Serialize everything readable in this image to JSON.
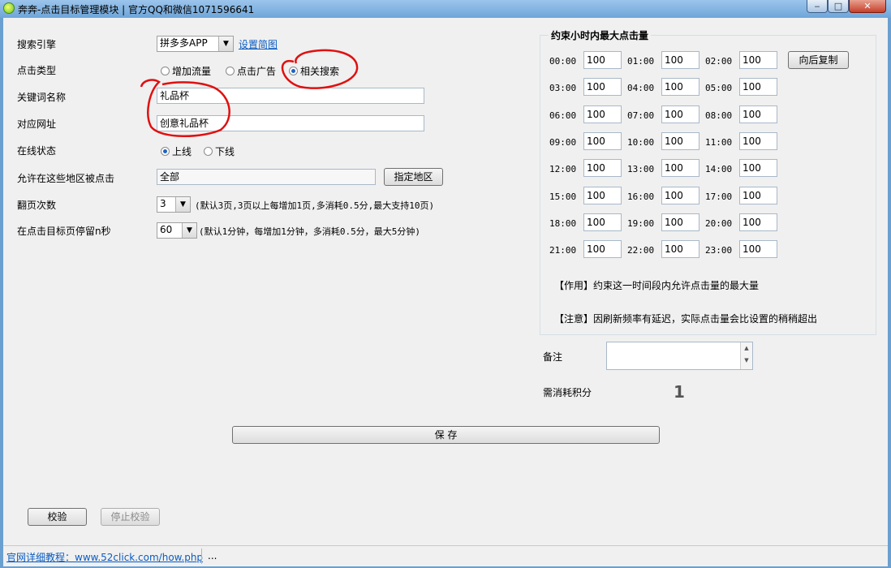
{
  "window": {
    "title": "奔奔-点击目标管理模块 | 官方QQ和微信1071596641",
    "minimize": "‒",
    "maximize": "□",
    "close": "✕"
  },
  "form": {
    "search_engine": {
      "label": "搜索引擎",
      "value": "拼多多APP",
      "link": "设置简图"
    },
    "click_type": {
      "label": "点击类型",
      "options": [
        "增加流量",
        "点击广告",
        "相关搜索"
      ],
      "selected": "相关搜索"
    },
    "keyword": {
      "label": "关键词名称",
      "value": "礼品杯"
    },
    "url": {
      "label": "对应网址",
      "value": "创意礼品杯"
    },
    "status": {
      "label": "在线状态",
      "options": [
        "上线",
        "下线"
      ],
      "selected": "上线"
    },
    "regions": {
      "label": "允许在这些地区被点击",
      "value": "全部",
      "button": "指定地区"
    },
    "pages": {
      "label": "翻页次数",
      "value": "3",
      "hint": "(默认3页,3页以上每增加1页,多消耗0.5分,最大支持10页)"
    },
    "stay": {
      "label": "在点击目标页停留n秒",
      "value": "60",
      "hint": "(默认1分钟，每增加1分钟，多消耗0.5分，最大5分钟)"
    }
  },
  "hourly": {
    "title": "约束小时内最大点击量",
    "copy_button": "向后复制",
    "hours": [
      "00:00",
      "01:00",
      "02:00",
      "03:00",
      "04:00",
      "05:00",
      "06:00",
      "07:00",
      "08:00",
      "09:00",
      "10:00",
      "11:00",
      "12:00",
      "13:00",
      "14:00",
      "15:00",
      "16:00",
      "17:00",
      "18:00",
      "19:00",
      "20:00",
      "21:00",
      "22:00",
      "23:00"
    ],
    "values": [
      "100",
      "100",
      "100",
      "100",
      "100",
      "100",
      "100",
      "100",
      "100",
      "100",
      "100",
      "100",
      "100",
      "100",
      "100",
      "100",
      "100",
      "100",
      "100",
      "100",
      "100",
      "100",
      "100",
      "100"
    ],
    "note_effect": "【作用】约束这一时间段内允许点击量的最大量",
    "note_warning": "【注意】因刷新频率有延迟，实际点击量会比设置的稍稍超出"
  },
  "remark": {
    "label": "备注",
    "value": ""
  },
  "cost": {
    "label": "需消耗积分",
    "value": "1"
  },
  "actions": {
    "save": "保 存",
    "verify": "校验",
    "stop_verify": "停止校验"
  },
  "statusbar": {
    "link": "官网详细教程：www.52click.com/how.php",
    "extra": "..."
  },
  "colors": {
    "annotation": "#e01010",
    "link": "#0b5cc2",
    "radio_dot": "#1c63c6"
  }
}
